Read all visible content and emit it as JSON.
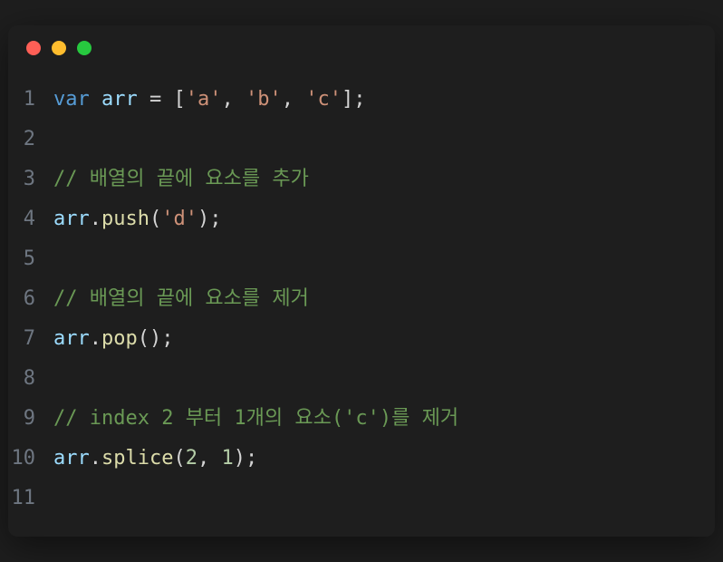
{
  "titlebar": {
    "dots": [
      "red",
      "yellow",
      "green"
    ]
  },
  "code": {
    "lines": [
      {
        "n": "1",
        "tokens": [
          {
            "t": "var",
            "c": "kw"
          },
          {
            "t": " ",
            "c": "op"
          },
          {
            "t": "arr",
            "c": "var"
          },
          {
            "t": " = [",
            "c": "op"
          },
          {
            "t": "'a'",
            "c": "str"
          },
          {
            "t": ", ",
            "c": "op"
          },
          {
            "t": "'b'",
            "c": "str"
          },
          {
            "t": ", ",
            "c": "op"
          },
          {
            "t": "'c'",
            "c": "str"
          },
          {
            "t": "];",
            "c": "op"
          }
        ]
      },
      {
        "n": "2",
        "tokens": []
      },
      {
        "n": "3",
        "tokens": [
          {
            "t": "// 배열의 끝에 요소를 추가",
            "c": "comment"
          }
        ]
      },
      {
        "n": "4",
        "tokens": [
          {
            "t": "arr",
            "c": "var"
          },
          {
            "t": ".",
            "c": "op"
          },
          {
            "t": "push",
            "c": "func"
          },
          {
            "t": "(",
            "c": "op"
          },
          {
            "t": "'d'",
            "c": "str"
          },
          {
            "t": ");",
            "c": "op"
          }
        ]
      },
      {
        "n": "5",
        "tokens": []
      },
      {
        "n": "6",
        "tokens": [
          {
            "t": "// 배열의 끝에 요소를 제거",
            "c": "comment"
          }
        ]
      },
      {
        "n": "7",
        "tokens": [
          {
            "t": "arr",
            "c": "var"
          },
          {
            "t": ".",
            "c": "op"
          },
          {
            "t": "pop",
            "c": "func"
          },
          {
            "t": "();",
            "c": "op"
          }
        ]
      },
      {
        "n": "8",
        "tokens": []
      },
      {
        "n": "9",
        "tokens": [
          {
            "t": "// index 2 부터 1개의 요소('c')를 제거",
            "c": "comment"
          }
        ]
      },
      {
        "n": "10",
        "tokens": [
          {
            "t": "arr",
            "c": "var"
          },
          {
            "t": ".",
            "c": "op"
          },
          {
            "t": "splice",
            "c": "func"
          },
          {
            "t": "(",
            "c": "op"
          },
          {
            "t": "2",
            "c": "num"
          },
          {
            "t": ", ",
            "c": "op"
          },
          {
            "t": "1",
            "c": "num"
          },
          {
            "t": ");",
            "c": "op"
          }
        ]
      },
      {
        "n": "11",
        "tokens": []
      }
    ]
  }
}
